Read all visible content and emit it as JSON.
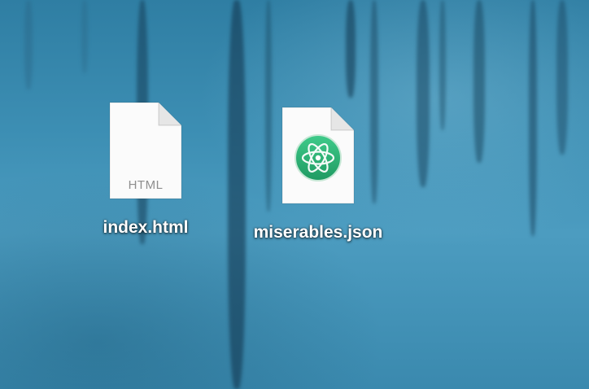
{
  "desktop": {
    "files": [
      {
        "name": "index.html",
        "type_label": "HTML",
        "icon": "html-document-icon"
      },
      {
        "name": "miserables.json",
        "type_label": "",
        "icon": "atom-document-icon"
      }
    ]
  },
  "colors": {
    "wallpaper": "#3d8fb4",
    "atom_badge": "#2bb57a",
    "label_text": "#ffffff"
  }
}
